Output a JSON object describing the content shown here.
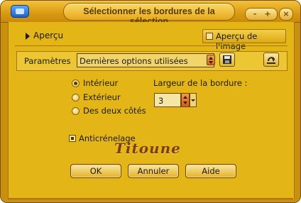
{
  "window": {
    "title": "Sélectionner les bordures de la sélection",
    "controls": {
      "minimize": "-",
      "maximize": "+",
      "close": "×"
    }
  },
  "preview_row": {
    "label": "Aperçu",
    "image_preview_label": "Aperçu de l'image",
    "image_preview_checked": false
  },
  "params": {
    "label": "Paramètres",
    "preset_value": "Dernières options utilisées",
    "save_icon": "floppy-disk-icon",
    "reset_icon": "reset-icon"
  },
  "border_position": {
    "options": [
      "Intérieur",
      "Extérieur",
      "Des deux côtés"
    ],
    "selected": "Intérieur"
  },
  "border_width": {
    "label": "Largeur de la bordure :",
    "value": "3"
  },
  "antialias": {
    "label": "Anticrénelage",
    "checked": true
  },
  "signature": "Titoune",
  "buttons": {
    "ok": "OK",
    "cancel": "Annuler",
    "help": "Aide"
  },
  "colors": {
    "frame": "#c9900f",
    "panel": "#e4b516",
    "title_pill": "#f4c23c",
    "accent_orange": "#d36a10"
  }
}
